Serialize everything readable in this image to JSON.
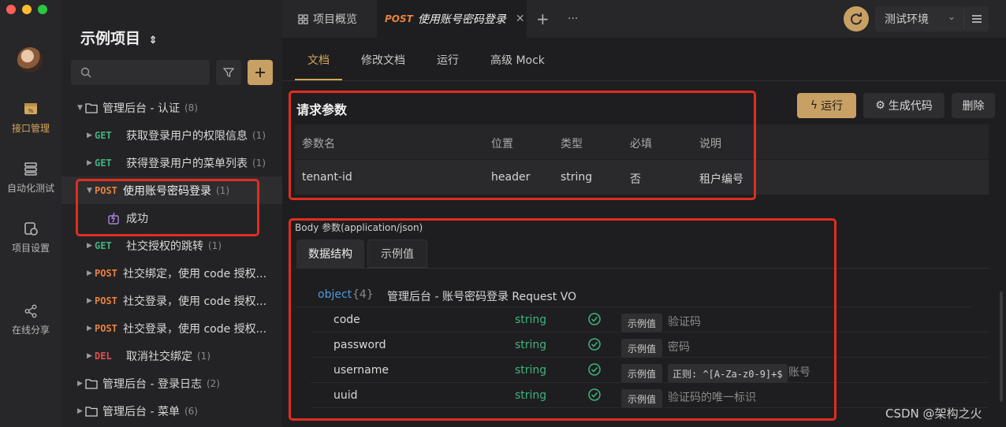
{
  "rail": {
    "items": [
      {
        "label": "接口管理",
        "icon": "api-management-icon",
        "active": true
      },
      {
        "label": "自动化测试",
        "icon": "automation-test-icon",
        "active": false
      },
      {
        "label": "项目设置",
        "icon": "project-settings-icon",
        "active": false
      },
      {
        "label": "在线分享",
        "icon": "share-icon",
        "active": false
      }
    ]
  },
  "sidebar": {
    "project_title": "示例项目",
    "search_placeholder": "",
    "tree": [
      {
        "type": "folder",
        "label": "管理后台 - 认证",
        "count": "(8)",
        "expanded": true
      },
      {
        "type": "api",
        "method": "GET",
        "label": "获取登录用户的权限信息",
        "count": "(1)"
      },
      {
        "type": "api",
        "method": "GET",
        "label": "获得登录用户的菜单列表",
        "count": "(1)"
      },
      {
        "type": "api",
        "method": "POST",
        "label": "使用账号密码登录",
        "count": "(1)",
        "expanded": true
      },
      {
        "type": "case",
        "label": "成功"
      },
      {
        "type": "api",
        "method": "GET",
        "label": "社交授权的跳转",
        "count": "(1)"
      },
      {
        "type": "api",
        "method": "POST",
        "label": "社交绑定，使用 code 授权...",
        "count": ""
      },
      {
        "type": "api",
        "method": "POST",
        "label": "社交登录，使用 code 授权...",
        "count": ""
      },
      {
        "type": "api",
        "method": "POST",
        "label": "社交登录，使用 code 授权...",
        "count": ""
      },
      {
        "type": "api",
        "method": "DEL",
        "label": "取消社交绑定",
        "count": "(1)"
      },
      {
        "type": "folder",
        "label": "管理后台 - 登录日志",
        "count": "(2)",
        "expanded": false
      },
      {
        "type": "folder",
        "label": "管理后台 - 菜单",
        "count": "(6)",
        "expanded": false
      }
    ]
  },
  "topbar": {
    "tabs": [
      {
        "label": "项目概览",
        "icon": "grid-icon"
      },
      {
        "method": "POST",
        "label": "使用账号密码登录",
        "active": true
      }
    ],
    "add_label": "+",
    "more_label": "···",
    "env_label": "测试环境"
  },
  "subtabs": [
    "文档",
    "修改文档",
    "运行",
    "高级 Mock"
  ],
  "actions": {
    "run": "运行",
    "gen_code": "生成代码",
    "delete": "删除"
  },
  "request_params": {
    "title": "请求参数",
    "headers": [
      "参数名",
      "位置",
      "类型",
      "必填",
      "说明"
    ],
    "rows": [
      [
        "tenant-id",
        "header",
        "string",
        "否",
        "租户编号"
      ]
    ]
  },
  "body": {
    "label": "Body 参数(application/json)",
    "tabs": [
      "数据结构",
      "示例值"
    ],
    "root": {
      "type": "object",
      "count": "{4}",
      "title": "管理后台 - 账号密码登录 Request VO"
    },
    "fields": [
      {
        "name": "code",
        "type": "string",
        "required": true,
        "eg": "示例值",
        "pattern": "",
        "desc": "验证码"
      },
      {
        "name": "password",
        "type": "string",
        "required": true,
        "eg": "示例值",
        "pattern": "",
        "desc": "密码"
      },
      {
        "name": "username",
        "type": "string",
        "required": true,
        "eg": "示例值",
        "pattern": "正则: ^[A-Za-z0-9]+$",
        "desc": "账号"
      },
      {
        "name": "uuid",
        "type": "string",
        "required": true,
        "eg": "示例值",
        "pattern": "",
        "desc": "验证码的唯一标识"
      }
    ]
  },
  "watermark": "CSDN @架构之火",
  "colors": {
    "accent": "#c9a063",
    "highlight_box": "#e02e1e",
    "get": "#3fb37f",
    "post": "#e8823e",
    "del": "#e05050"
  }
}
